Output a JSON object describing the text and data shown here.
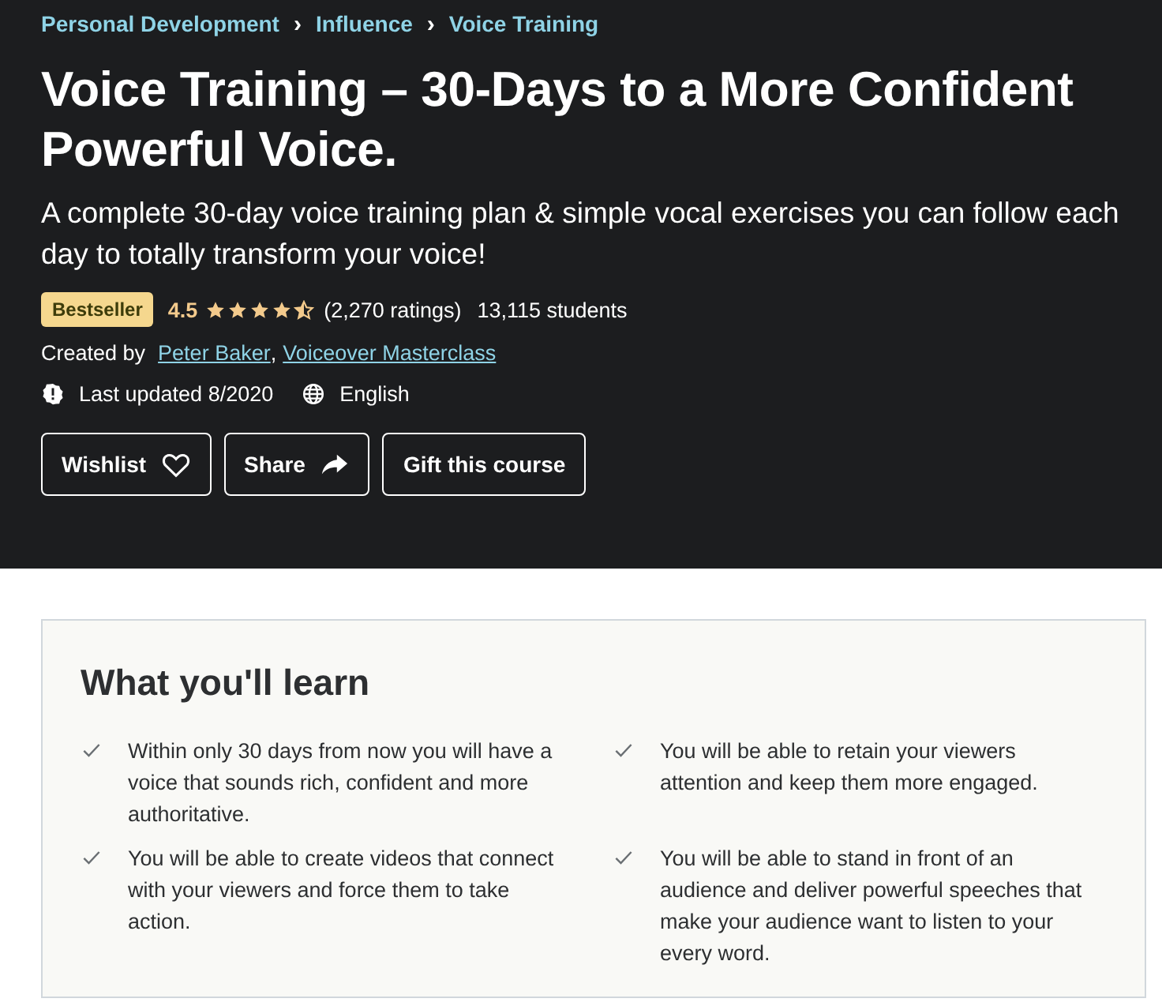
{
  "breadcrumbs": [
    "Personal Development",
    "Influence",
    "Voice Training"
  ],
  "separator": "›",
  "title": "Voice Training – 30-Days to a More Confident Powerful Voice.",
  "subtitle": "A complete 30-day voice training plan & simple vocal exercises you can follow each day to totally transform your voice!",
  "badge": "Bestseller",
  "rating": {
    "value": "4.5",
    "stars": 4.5,
    "count": "(2,270 ratings)",
    "students": "13,115 students"
  },
  "created_by": {
    "label": "Created by",
    "authors": [
      "Peter Baker",
      "Voiceover Masterclass"
    ],
    "separator": ","
  },
  "last_updated": "Last updated 8/2020",
  "language": "English",
  "buttons": [
    {
      "label": "Wishlist",
      "kind": "wishlist"
    },
    {
      "label": "Share",
      "kind": "share"
    },
    {
      "label": "Gift this course",
      "kind": "gift"
    }
  ],
  "learn": {
    "heading": "What you'll learn",
    "items": [
      "Within only 30 days from now you will have a voice that sounds rich, confident and more authoritative.",
      "You will be able to retain your viewers attention and keep them more engaged.",
      "You will be able to create videos that connect with your viewers and force them to take action.",
      "You will be able to stand in front of an audience and deliver powerful speeches that make your audience want to listen to your every word."
    ]
  }
}
